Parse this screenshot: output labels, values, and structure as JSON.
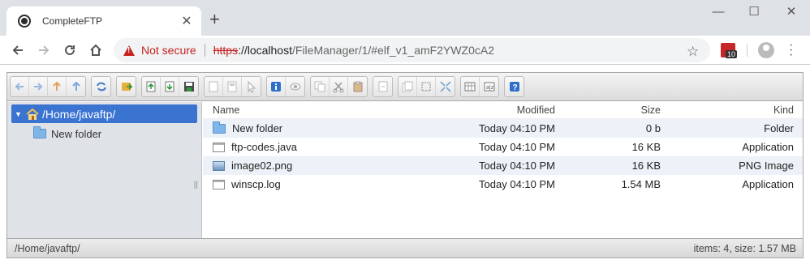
{
  "browser": {
    "tab_title": "CompleteFTP",
    "tab_close": "✕",
    "new_tab": "+",
    "window_controls": {
      "minimize": "—",
      "maximize": "☐",
      "close": "✕"
    },
    "security_label": "Not secure",
    "url": {
      "scheme": "https",
      "rest_host": "://localhost",
      "path": "/FileManager/1/#elf_v1_amF2YWZ0cA2"
    },
    "extension_badge": "10"
  },
  "toolbar": {
    "groups": [
      [
        "back-icon",
        "forward-icon",
        "up-icon",
        "home-icon"
      ],
      [
        "reload-icon"
      ],
      [
        "open-icon"
      ],
      [
        "upload-icon",
        "download-icon",
        "save-icon"
      ],
      [
        "new-folder-icon",
        "new-file-icon",
        "select-icon"
      ],
      [
        "info-icon",
        "preview-icon"
      ],
      [
        "copy-icon",
        "cut-icon",
        "paste-icon"
      ],
      [
        "rename-icon"
      ],
      [
        "duplicate-icon",
        "select-all-icon",
        "resize-icon"
      ],
      [
        "view-icon",
        "sort-icon"
      ],
      [
        "help-icon"
      ]
    ]
  },
  "tree": {
    "root_label": "/Home/javaftp/",
    "children": [
      {
        "label": "New folder"
      }
    ]
  },
  "list": {
    "headers": {
      "name": "Name",
      "modified": "Modified",
      "size": "Size",
      "kind": "Kind"
    },
    "rows": [
      {
        "name": "New folder",
        "modified": "Today 04:10 PM",
        "size": "0 b",
        "kind": "Folder",
        "icon": "folder-icon"
      },
      {
        "name": "ftp-codes.java",
        "modified": "Today 04:10 PM",
        "size": "16 KB",
        "kind": "Application",
        "icon": "file-icon"
      },
      {
        "name": "image02.png",
        "modified": "Today 04:10 PM",
        "size": "16 KB",
        "kind": "PNG Image",
        "icon": "image-icon"
      },
      {
        "name": "winscp.log",
        "modified": "Today 04:10 PM",
        "size": "1.54 MB",
        "kind": "Application",
        "icon": "file-icon"
      }
    ]
  },
  "status": {
    "path": "/Home/javaftp/",
    "summary": "items: 4, size: 1.57 MB"
  },
  "colors": {
    "selection": "#3b73d1",
    "warning": "#c5221f",
    "tree_bg": "#dfe3e8"
  }
}
